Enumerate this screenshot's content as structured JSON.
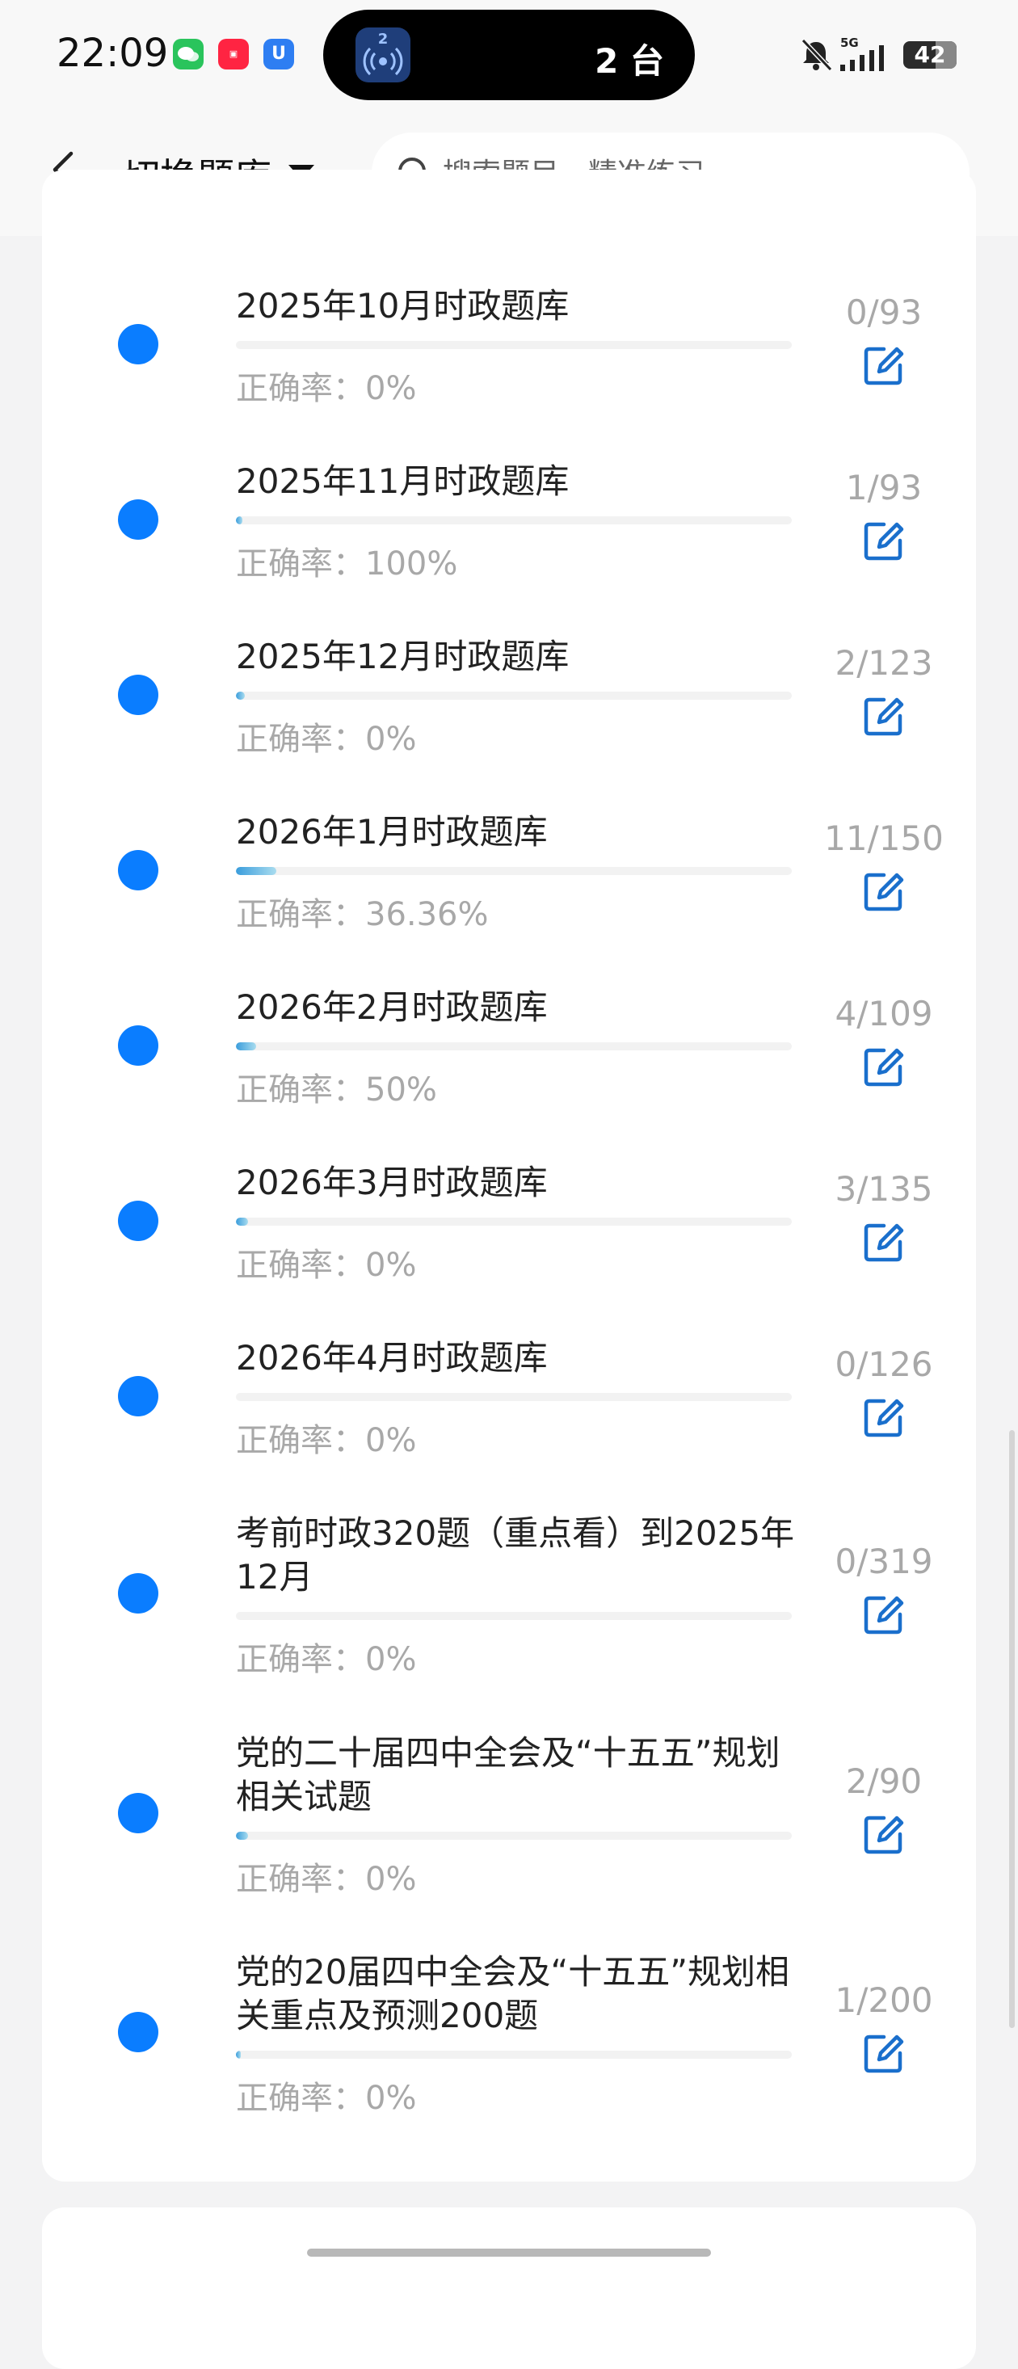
{
  "status_bar": {
    "time": "22:09",
    "pill_count": "2",
    "pill_text": "2 台",
    "battery": "42",
    "network": "5G"
  },
  "header": {
    "back_icon": "chevron-left-icon",
    "switch_label": "切换题库",
    "search_placeholder": "搜索题目，精准练习"
  },
  "items": [
    {
      "title": "2025年10月时政题库",
      "accuracy": "正确率：0%",
      "count": "0/93",
      "progress": 0.0
    },
    {
      "title": "2025年11月时政题库",
      "accuracy": "正确率：100%",
      "count": "1/93",
      "progress": 0.011
    },
    {
      "title": "2025年12月时政题库",
      "accuracy": "正确率：0%",
      "count": "2/123",
      "progress": 0.016
    },
    {
      "title": "2026年1月时政题库",
      "accuracy": "正确率：36.36%",
      "count": "11/150",
      "progress": 0.073
    },
    {
      "title": "2026年2月时政题库",
      "accuracy": "正确率：50%",
      "count": "4/109",
      "progress": 0.037
    },
    {
      "title": "2026年3月时政题库",
      "accuracy": "正确率：0%",
      "count": "3/135",
      "progress": 0.022
    },
    {
      "title": "2026年4月时政题库",
      "accuracy": "正确率：0%",
      "count": "0/126",
      "progress": 0.0
    },
    {
      "title": "考前时政320题（重点看）到2025年12月",
      "accuracy": "正确率：0%",
      "count": "0/319",
      "progress": 0.0
    },
    {
      "title": "党的二十届四中全会及“十五五”规划相关试题",
      "accuracy": "正确率：0%",
      "count": "2/90",
      "progress": 0.022
    },
    {
      "title": "党的20届四中全会及“十五五”规划相关重点及预测200题",
      "accuracy": "正确率：0%",
      "count": "1/200",
      "progress": 0.005
    }
  ],
  "colors": {
    "accent": "#0a7dff",
    "edit_icon": "#1a6fcc",
    "muted_text": "#a8a8a8",
    "progress_start": "#3a9ddc",
    "progress_end": "#a9dcef"
  }
}
